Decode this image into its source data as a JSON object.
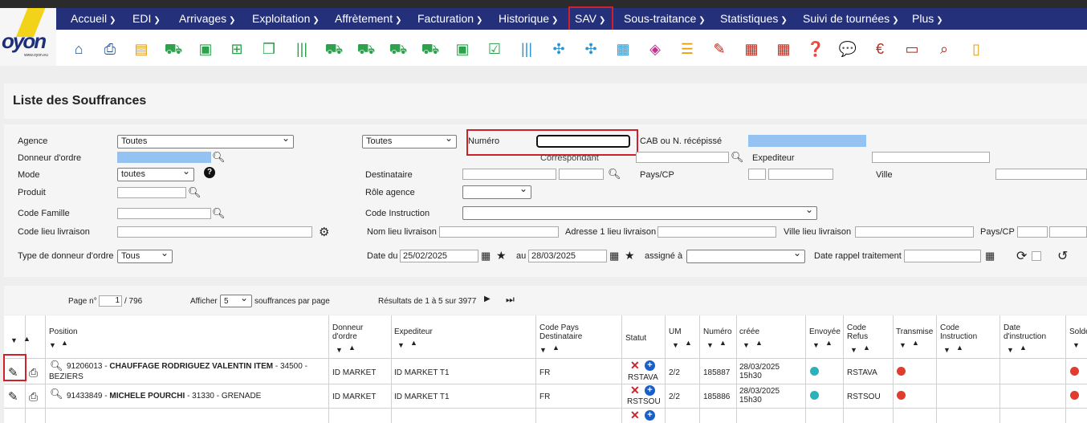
{
  "nav": [
    {
      "id": "accueil",
      "label": "Accueil"
    },
    {
      "id": "edi",
      "label": "EDI"
    },
    {
      "id": "arrivages",
      "label": "Arrivages"
    },
    {
      "id": "exploitation",
      "label": "Exploitation"
    },
    {
      "id": "affretement",
      "label": "Affrètement"
    },
    {
      "id": "facturation",
      "label": "Facturation"
    },
    {
      "id": "historique",
      "label": "Historique"
    },
    {
      "id": "sav",
      "label": "SAV"
    },
    {
      "id": "sous-traitance",
      "label": "Sous-traitance"
    },
    {
      "id": "statistiques",
      "label": "Statistiques"
    },
    {
      "id": "suivi",
      "label": "Suivi de tournées"
    },
    {
      "id": "plus",
      "label": "Plus"
    }
  ],
  "logo": {
    "text": "oyon",
    "sub": "www.oyon.eu"
  },
  "page_title": "Liste des Souffrances",
  "filters": {
    "agence": {
      "label": "Agence",
      "value": "Toutes"
    },
    "agence2": {
      "value": "Toutes"
    },
    "numero": {
      "label": "Numéro",
      "value": ""
    },
    "cab": {
      "label": "CAB ou N. récépissé"
    },
    "donneur": {
      "label": "Donneur d'ordre"
    },
    "correspondant": {
      "label": "Correspondant"
    },
    "expediteur": {
      "label": "Expediteur"
    },
    "mode": {
      "label": "Mode",
      "value": "toutes"
    },
    "destinataire": {
      "label": "Destinataire"
    },
    "payscp": {
      "label": "Pays/CP"
    },
    "ville": {
      "label": "Ville"
    },
    "produit": {
      "label": "Produit"
    },
    "role": {
      "label": "Rôle agence"
    },
    "code_famille": {
      "label": "Code Famille"
    },
    "code_instruction": {
      "label": "Code Instruction"
    },
    "code_lieu": {
      "label": "Code lieu livraison"
    },
    "nom_lieu": {
      "label": "Nom lieu livraison"
    },
    "adresse_lieu": {
      "label": "Adresse 1 lieu livraison"
    },
    "ville_lieu": {
      "label": "Ville lieu livraison"
    },
    "payscp2": {
      "label": "Pays/CP"
    },
    "type_donneur": {
      "label": "Type de donneur d'ordre",
      "value": "Tous"
    },
    "date_du": {
      "label": "Date du",
      "value": "25/02/2025"
    },
    "date_au": {
      "label": "au",
      "value": "28/03/2025"
    },
    "assigne": {
      "label": "assigné à"
    },
    "date_rappel": {
      "label": "Date rappel traitement"
    }
  },
  "pager": {
    "page_label": "Page n°",
    "page_value": "1",
    "page_total": "/ 796",
    "afficher": "Afficher",
    "per_page": "5",
    "per_page_suffix": "souffrances par page",
    "results": "Résultats de 1 à 5 sur 3977"
  },
  "columns": {
    "position": "Position",
    "donneur": [
      "Donneur",
      "d'ordre"
    ],
    "expediteur": "Expediteur",
    "code_pays": [
      "Code Pays",
      "Destinataire"
    ],
    "statut": "Statut",
    "um": "UM",
    "numero": "Numéro",
    "creee": "créée",
    "envoyee": "Envoyée",
    "code_refus": [
      "Code",
      "Refus"
    ],
    "transmise": "Transmise",
    "code_instruction": [
      "Code",
      "Instruction"
    ],
    "date_instruction": [
      "Date",
      "d'instruction"
    ],
    "solde": "Solde"
  },
  "rows": [
    {
      "num": "91206013",
      "name": "CHAUFFAGE RODRIGUEZ VALENTIN ITEM",
      "cp": "- 34500 -",
      "city": "BEZIERS",
      "donneur": "ID MARKET",
      "expediteur": "ID MARKET T1",
      "pays": "FR",
      "statut": "RSTAVA",
      "um": "2/2",
      "numero": "185887",
      "creee": [
        "28/03/2025",
        "15h30"
      ],
      "code_refus": "RSTAVA"
    },
    {
      "num": "91433849",
      "name": "MICHELE POURCHI",
      "cp": "- 31330 - GRENADE",
      "city": "",
      "donneur": "ID MARKET",
      "expediteur": "ID MARKET T1",
      "pays": "FR",
      "statut": "RSTSOU",
      "um": "2/2",
      "numero": "185886",
      "creee": [
        "28/03/2025",
        "15h30"
      ],
      "code_refus": "RSTSOU"
    }
  ]
}
